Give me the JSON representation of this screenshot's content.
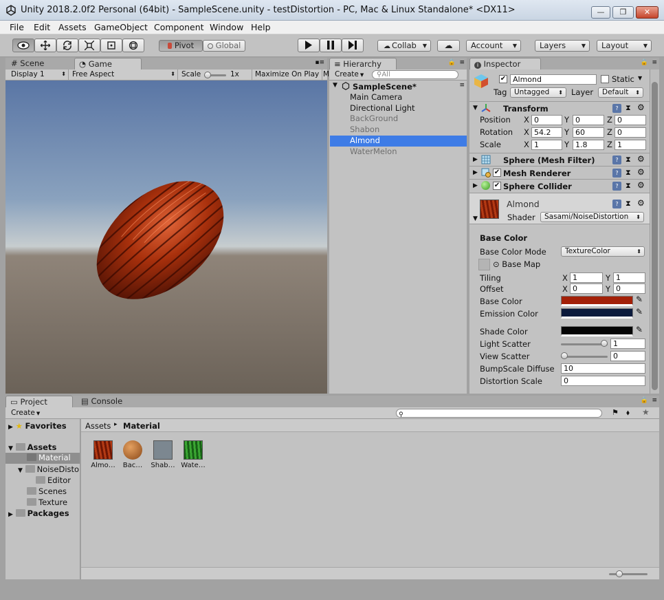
{
  "window": {
    "title": "Unity 2018.2.0f2 Personal (64bit) - SampleScene.unity - testDistortion - PC, Mac & Linux Standalone* <DX11>",
    "minimize": "—",
    "restore": "❐",
    "close": "✕"
  },
  "menu": [
    "File",
    "Edit",
    "Assets",
    "GameObject",
    "Component",
    "Window",
    "Help"
  ],
  "toolbar": {
    "pivot": "Pivot",
    "global": "Global",
    "collab": "Collab",
    "account": "Account",
    "layers": "Layers",
    "layout": "Layout",
    "play_icon": "play-icon",
    "pause_icon": "pause-icon",
    "step_icon": "step-icon"
  },
  "game_view": {
    "tab_scene": "Scene",
    "tab_game": "Game",
    "display": "Display 1",
    "aspect": "Free Aspect",
    "scale_label": "Scale",
    "scale_value": "1x",
    "maximize": "Maximize On Play",
    "overflow": "M"
  },
  "hierarchy": {
    "tab": "Hierarchy",
    "create": "Create",
    "search_placeholder": "All",
    "scene": "SampleScene*",
    "items": [
      {
        "name": "Main Camera",
        "state": "normal"
      },
      {
        "name": "Directional Light",
        "state": "normal"
      },
      {
        "name": "BackGround",
        "state": "dim"
      },
      {
        "name": "Shabon",
        "state": "dim"
      },
      {
        "name": "Almond",
        "state": "selected"
      },
      {
        "name": "WaterMelon",
        "state": "dim"
      }
    ]
  },
  "inspector": {
    "tab": "Inspector",
    "object_name": "Almond",
    "static_label": "Static",
    "tag_label": "Tag",
    "tag_value": "Untagged",
    "layer_label": "Layer",
    "layer_value": "Default",
    "transform": {
      "title": "Transform",
      "position_label": "Position",
      "rotation_label": "Rotation",
      "scale_label": "Scale",
      "position": {
        "x": "0",
        "y": "0",
        "z": "0"
      },
      "rotation": {
        "x": "54.2",
        "y": "60",
        "z": "0"
      },
      "scale": {
        "x": "1",
        "y": "1.8",
        "z": "1"
      }
    },
    "axis": {
      "x": "X",
      "y": "Y",
      "z": "Z"
    },
    "components": [
      "Sphere (Mesh Filter)",
      "Mesh Renderer",
      "Sphere Collider"
    ],
    "material": {
      "name": "Almond",
      "shader_label": "Shader",
      "shader_value": "Sasami/NoiseDistortion",
      "section": "Base Color",
      "base_color_mode_label": "Base Color Mode",
      "base_color_mode_value": "TextureColor",
      "base_map_label": "Base Map",
      "tiling_label": "Tiling",
      "offset_label": "Offset",
      "tiling": {
        "x": "1",
        "y": "1"
      },
      "offset": {
        "x": "0",
        "y": "0"
      },
      "base_color_label": "Base Color",
      "base_color": "#a32008",
      "emission_color_label": "Emission Color",
      "emission_color": "#0b1a3c",
      "shade_color_label": "Shade Color",
      "shade_color": "#050505",
      "light_scatter_label": "Light Scatter",
      "light_scatter_value": "1",
      "light_scatter_level": 1,
      "view_scatter_label": "View Scatter",
      "view_scatter_value": "0",
      "view_scatter_level": 0,
      "bump_label": "BumpScale Diffuse",
      "bump_value": "10",
      "distortion_label": "Distortion Scale",
      "distortion_value": "0"
    }
  },
  "project": {
    "tab_project": "Project",
    "tab_console": "Console",
    "create": "Create",
    "favorites": "Favorites",
    "assets": "Assets",
    "folders": [
      "Material",
      "NoiseDisto",
      "Editor",
      "Scenes",
      "Texture"
    ],
    "packages": "Packages",
    "breadcrumb_root": "Assets",
    "breadcrumb_sep": "▸",
    "breadcrumb_current": "Material",
    "thumbnails": [
      {
        "label": "Almo…",
        "color": "#9c2a0e"
      },
      {
        "label": "Bac…",
        "color": "#b0652a"
      },
      {
        "label": "Shab…",
        "color": "#7c8790"
      },
      {
        "label": "Wate…",
        "color": "#2e8a2a"
      }
    ]
  }
}
